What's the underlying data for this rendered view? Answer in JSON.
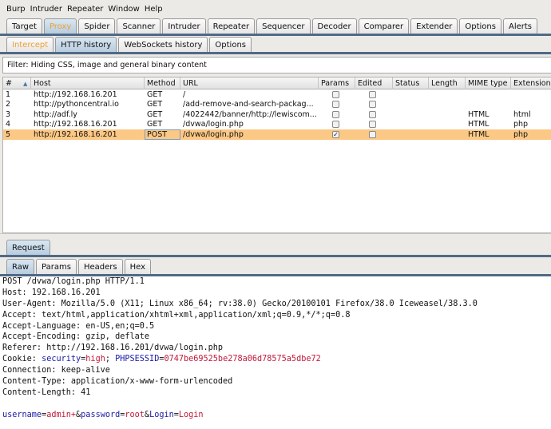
{
  "menu": [
    "Burp",
    "Intruder",
    "Repeater",
    "Window",
    "Help"
  ],
  "main_tabs": [
    {
      "label": "Target"
    },
    {
      "label": "Proxy",
      "selected": true
    },
    {
      "label": "Spider"
    },
    {
      "label": "Scanner"
    },
    {
      "label": "Intruder"
    },
    {
      "label": "Repeater"
    },
    {
      "label": "Sequencer"
    },
    {
      "label": "Decoder"
    },
    {
      "label": "Comparer"
    },
    {
      "label": "Extender"
    },
    {
      "label": "Options"
    },
    {
      "label": "Alerts"
    }
  ],
  "proxy_tabs": [
    {
      "label": "Intercept"
    },
    {
      "label": "HTTP history",
      "selected": true
    },
    {
      "label": "WebSockets history"
    },
    {
      "label": "Options"
    }
  ],
  "filter": "Filter: Hiding CSS, image and general binary content",
  "columns": [
    "#",
    "Host",
    "Method",
    "URL",
    "Params",
    "Edited",
    "Status",
    "Length",
    "MIME type",
    "Extension"
  ],
  "rows": [
    {
      "num": "1",
      "host": "http://192.168.16.201",
      "method": "GET",
      "url": "/",
      "params": false,
      "edited": false,
      "status": "",
      "length": "",
      "mime": "",
      "ext": ""
    },
    {
      "num": "2",
      "host": "http://pythoncentral.io",
      "method": "GET",
      "url": "/add-remove-and-search-packag...",
      "params": false,
      "edited": false,
      "status": "",
      "length": "",
      "mime": "",
      "ext": ""
    },
    {
      "num": "3",
      "host": "http://adf.ly",
      "method": "GET",
      "url": "/4022442/banner/http://lewiscom...",
      "params": false,
      "edited": false,
      "status": "",
      "length": "",
      "mime": "HTML",
      "ext": "html"
    },
    {
      "num": "4",
      "host": "http://192.168.16.201",
      "method": "GET",
      "url": "/dvwa/login.php",
      "params": false,
      "edited": false,
      "status": "",
      "length": "",
      "mime": "HTML",
      "ext": "php"
    },
    {
      "num": "5",
      "host": "http://192.168.16.201",
      "method": "POST",
      "url": "/dvwa/login.php",
      "params": true,
      "edited": false,
      "status": "",
      "length": "",
      "mime": "HTML",
      "ext": "php",
      "selected": true
    }
  ],
  "request_tab": "Request",
  "request_subtabs": [
    {
      "label": "Raw",
      "selected": true
    },
    {
      "label": "Params"
    },
    {
      "label": "Headers"
    },
    {
      "label": "Hex"
    }
  ],
  "raw_lines": [
    [
      {
        "t": "POST /dvwa/login.php HTTP/1.1"
      }
    ],
    [
      {
        "t": "Host: 192.168.16.201"
      }
    ],
    [
      {
        "t": "User-Agent: Mozilla/5.0 (X11; Linux x86_64; rv:38.0) Gecko/20100101 Firefox/38.0 Iceweasel/38.3.0"
      }
    ],
    [
      {
        "t": "Accept: text/html,application/xhtml+xml,application/xml;q=0.9,*/*;q=0.8"
      }
    ],
    [
      {
        "t": "Accept-Language: en-US,en;q=0.5"
      }
    ],
    [
      {
        "t": "Accept-Encoding: gzip, deflate"
      }
    ],
    [
      {
        "t": "Referer: http://192.168.16.201/dvwa/login.php"
      }
    ],
    [
      {
        "t": "Cookie: "
      },
      {
        "t": "security",
        "c": "k"
      },
      {
        "t": "="
      },
      {
        "t": "high",
        "c": "v"
      },
      {
        "t": "; "
      },
      {
        "t": "PHPSESSID",
        "c": "k"
      },
      {
        "t": "="
      },
      {
        "t": "0747be69525be278a06d78575a5dbe72",
        "c": "v"
      }
    ],
    [
      {
        "t": "Connection: keep-alive"
      }
    ],
    [
      {
        "t": "Content-Type: application/x-www-form-urlencoded"
      }
    ],
    [
      {
        "t": "Content-Length: 41"
      }
    ],
    [
      {
        "t": ""
      }
    ],
    [
      {
        "t": "username",
        "c": "k"
      },
      {
        "t": "="
      },
      {
        "t": "admin+",
        "c": "v"
      },
      {
        "t": "&"
      },
      {
        "t": "password",
        "c": "k"
      },
      {
        "t": "="
      },
      {
        "t": "root",
        "c": "v"
      },
      {
        "t": "&"
      },
      {
        "t": "Login",
        "c": "k"
      },
      {
        "t": "="
      },
      {
        "t": "Login",
        "c": "v"
      }
    ]
  ],
  "colors": {
    "selection": "#fcc885",
    "key": "#1a1aa6",
    "value": "#c2183a",
    "tab_highlight": "#f0a030"
  }
}
